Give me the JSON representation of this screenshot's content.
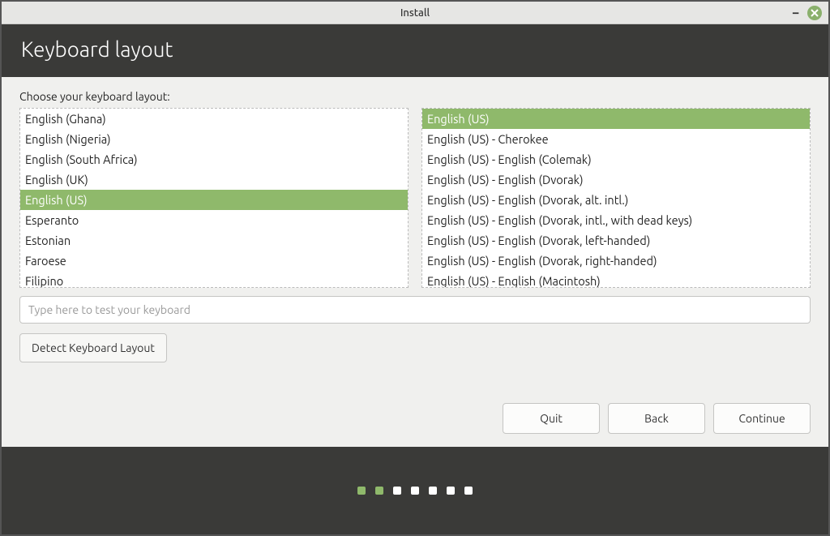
{
  "window": {
    "title": "Install"
  },
  "header": {
    "title": "Keyboard layout"
  },
  "content": {
    "prompt": "Choose your keyboard layout:",
    "left_list": [
      "English (Ghana)",
      "English (Nigeria)",
      "English (South Africa)",
      "English (UK)",
      "English (US)",
      "Esperanto",
      "Estonian",
      "Faroese",
      "Filipino"
    ],
    "left_selected_index": 4,
    "right_list": [
      "English (US)",
      "English (US) - Cherokee",
      "English (US) - English (Colemak)",
      "English (US) - English (Dvorak)",
      "English (US) - English (Dvorak, alt. intl.)",
      "English (US) - English (Dvorak, intl., with dead keys)",
      "English (US) - English (Dvorak, left-handed)",
      "English (US) - English (Dvorak, right-handed)",
      "English (US) - English (Macintosh)"
    ],
    "right_selected_index": 0,
    "test_placeholder": "Type here to test your keyboard",
    "detect_button": "Detect Keyboard Layout"
  },
  "nav": {
    "quit": "Quit",
    "back": "Back",
    "continue": "Continue"
  },
  "progress": {
    "total": 7,
    "active": [
      0,
      1
    ]
  }
}
